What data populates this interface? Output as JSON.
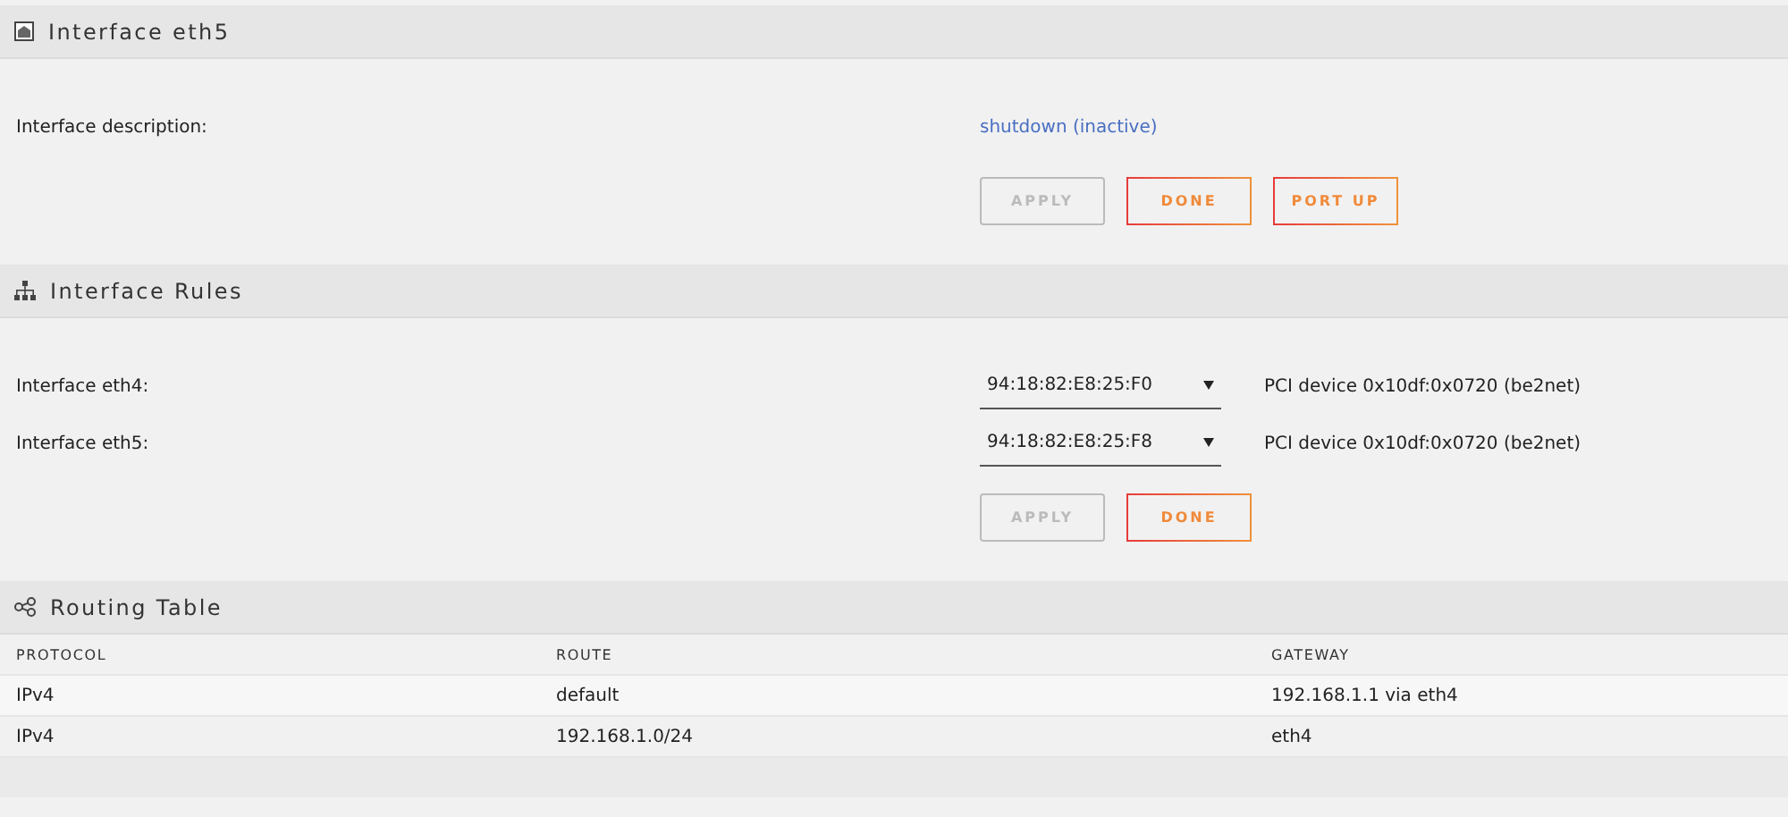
{
  "sections": [
    {
      "kind": "form",
      "title": "Interface eth5",
      "rows": [
        {
          "label": "Interface description:",
          "value": "shutdown (inactive)",
          "kind": "link"
        }
      ],
      "buttons": [
        {
          "label": "APPLY",
          "disabled": true
        },
        {
          "label": "DONE",
          "disabled": false
        },
        {
          "label": "PORT UP",
          "disabled": false
        }
      ]
    },
    {
      "kind": "form",
      "title": "Interface Rules",
      "rows": [
        {
          "label": "Interface eth4:",
          "value": "94:18:82:E8:25:F0",
          "kind": "select",
          "note": "PCI device 0x10df:0x0720 (be2net)"
        },
        {
          "label": "Interface eth5:",
          "value": "94:18:82:E8:25:F8",
          "kind": "select",
          "note": "PCI device 0x10df:0x0720 (be2net)"
        }
      ],
      "buttons": [
        {
          "label": "APPLY",
          "disabled": true
        },
        {
          "label": "DONE",
          "disabled": false
        }
      ]
    },
    {
      "kind": "table",
      "title": "Routing Table",
      "columns": [
        "PROTOCOL",
        "ROUTE",
        "GATEWAY"
      ],
      "rows": [
        [
          "IPv4",
          "default",
          "192.168.1.1 via eth4"
        ],
        [
          "IPv4",
          "192.168.1.0/24",
          "eth4"
        ]
      ]
    }
  ]
}
